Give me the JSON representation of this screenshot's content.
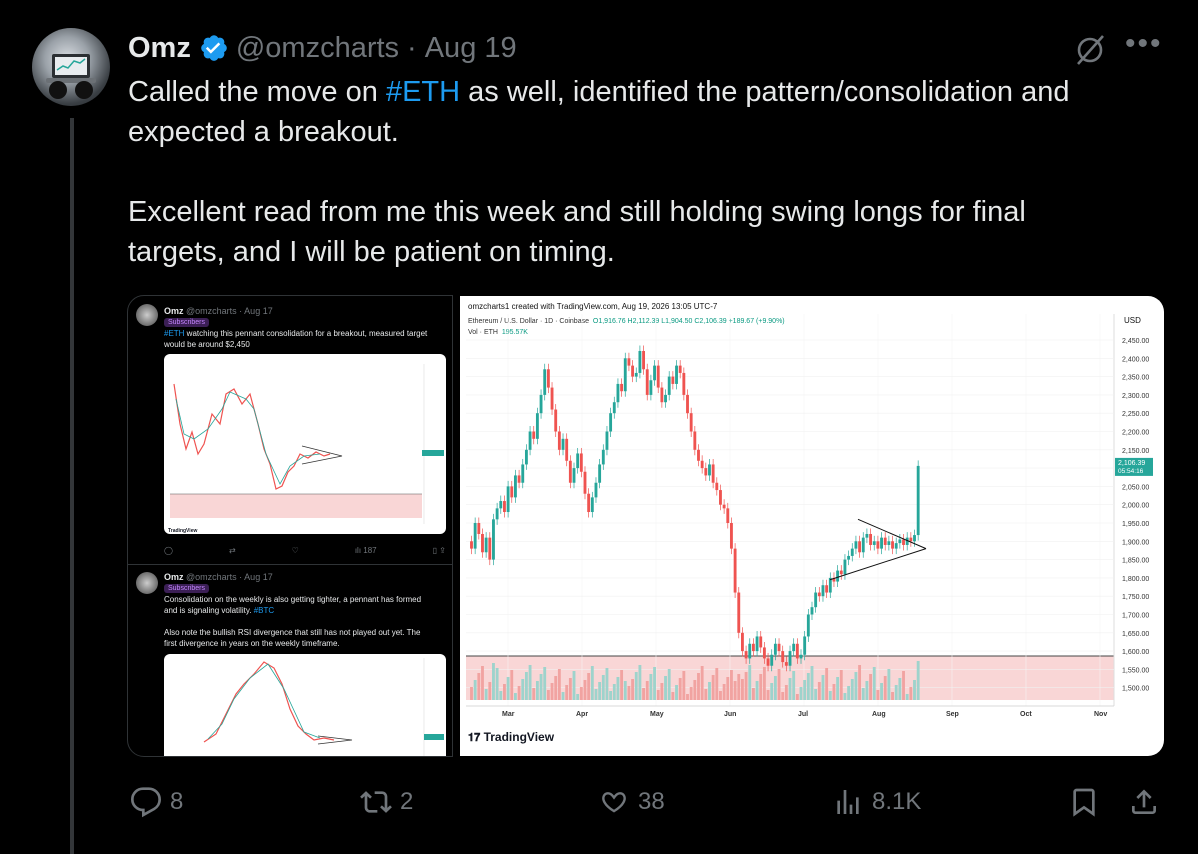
{
  "author": {
    "display_name": "Omz",
    "handle": "@omzcharts",
    "separator": "·",
    "date": "Aug 19"
  },
  "tweet": {
    "line1_pre": "Called the move on ",
    "line1_tag": "#ETH",
    "line1_post": " as well, identified the pattern/consolidation and",
    "line2": "expected a breakout.",
    "line3": "Excellent read from me this week and still holding swing longs for final",
    "line4": "targets, and I will be patient on timing."
  },
  "quoted_1": {
    "display_name": "Omz",
    "handle": "@omzcharts · Aug 17",
    "badge": "Subscribers",
    "tag": "#ETH",
    "text_rest": " watching this pennant consolidation for a breakout, measured target",
    "text_line2": "would be around $2,450",
    "views": "187"
  },
  "quoted_2": {
    "display_name": "Omz",
    "handle": "@omzcharts · Aug 17",
    "badge": "Subscribers",
    "text_line1": "Consolidation on the weekly is also getting tighter, a pennant has formed",
    "text_line2_pre": "and is signaling volatility. ",
    "text_line2_tag": "#BTC",
    "text_line3": "Also note the bullish RSI divergence that still has not played out yet. The",
    "text_line4": "first divergence in years on the weekly timeframe."
  },
  "tradingview": {
    "caption": "omzcharts1 created with TradingView.com, Aug 19, 2026 13:05 UTC-7",
    "legend_symbol": "Ethereum / U.S. Dollar · 1D · Coinbase",
    "legend_ohlc": "O1,916.76  H2,112.39  L1,904.50  C2,106.39  +189.67 (+9.90%)",
    "legend_vol": "Vol · ETH",
    "legend_vol_value": "195.57K",
    "currency": "USD",
    "logo": "TradingView",
    "last_price": "2,106.39",
    "countdown": "05:54:16",
    "y_ticks": [
      "2,450.00",
      "2,400.00",
      "2,350.00",
      "2,300.00",
      "2,250.00",
      "2,200.00",
      "2,150.00",
      "2,100.00",
      "2,050.00",
      "2,000.00",
      "1,950.00",
      "1,900.00",
      "1,850.00",
      "1,800.00",
      "1,750.00",
      "1,700.00",
      "1,650.00",
      "1,600.00",
      "1,550.00",
      "1,500.00"
    ],
    "x_ticks": [
      "Mar",
      "Apr",
      "May",
      "Jun",
      "Jul",
      "Aug",
      "Sep",
      "Oct",
      "Nov"
    ],
    "colors": {
      "up": "#26a69a",
      "down": "#ef5350",
      "volume_bg": "#f9d6d6"
    }
  },
  "actions": {
    "replies": "8",
    "reposts": "2",
    "likes": "38",
    "views": "8.1K"
  },
  "icons": [
    "verified-badge-icon",
    "grok-icon",
    "more-icon",
    "reply-icon",
    "repost-icon",
    "like-icon",
    "views-icon",
    "bookmark-icon",
    "share-icon"
  ]
}
